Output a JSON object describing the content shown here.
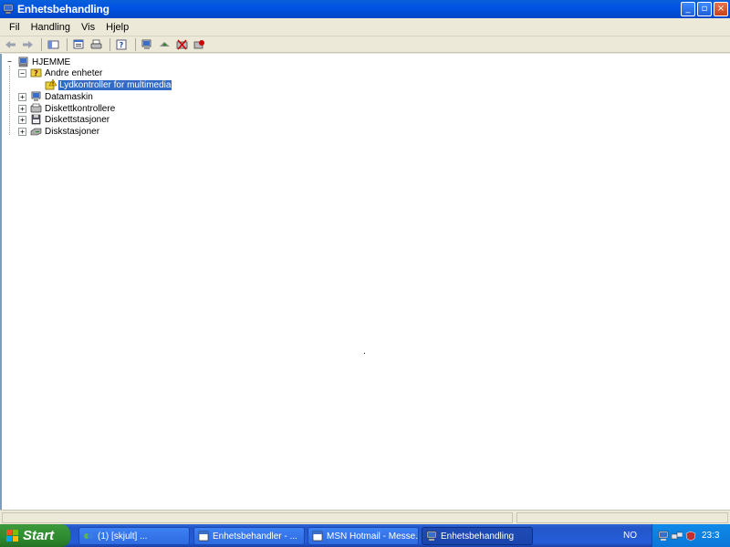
{
  "window": {
    "title": "Enhetsbehandling",
    "controls": {
      "minimize": "_",
      "maximize": "▫",
      "close": "×"
    }
  },
  "menu": [
    "Fil",
    "Handling",
    "Vis",
    "Hjelp"
  ],
  "toolbar": {
    "icons": [
      "back-arrow-icon",
      "forward-arrow-icon",
      "console-tree-icon",
      "properties-icon",
      "print-icon",
      "help-icon",
      "scan-hardware-icon",
      "update-driver-icon",
      "uninstall-icon",
      "disable-icon"
    ]
  },
  "tree": {
    "root": "HJEMME",
    "nodes": [
      {
        "label": "Andre enheter",
        "expander": "−"
      },
      {
        "label": "Lydkontroller for multimedia",
        "selected": true
      },
      {
        "label": "Datamaskin",
        "expander": "+"
      },
      {
        "label": "Diskettkontrollere",
        "expander": "+"
      },
      {
        "label": "Diskettstasjoner",
        "expander": "+"
      },
      {
        "label": "Diskstasjoner",
        "expander": "+"
      }
    ]
  },
  "taskbar": {
    "start_label": "Start",
    "tasks": [
      {
        "label": "(1) [skjult] ..."
      },
      {
        "label": "Enhetsbehandler - ..."
      },
      {
        "label": "MSN Hotmail - Messe..."
      },
      {
        "label": "Enhetsbehandling",
        "active": true
      }
    ],
    "language": "NO",
    "clock": "23:3"
  },
  "colors": {
    "titlebar": "#0054e3",
    "selection": "#316ac5",
    "start_button": "#2f8b2f",
    "taskbar": "#245dda"
  }
}
